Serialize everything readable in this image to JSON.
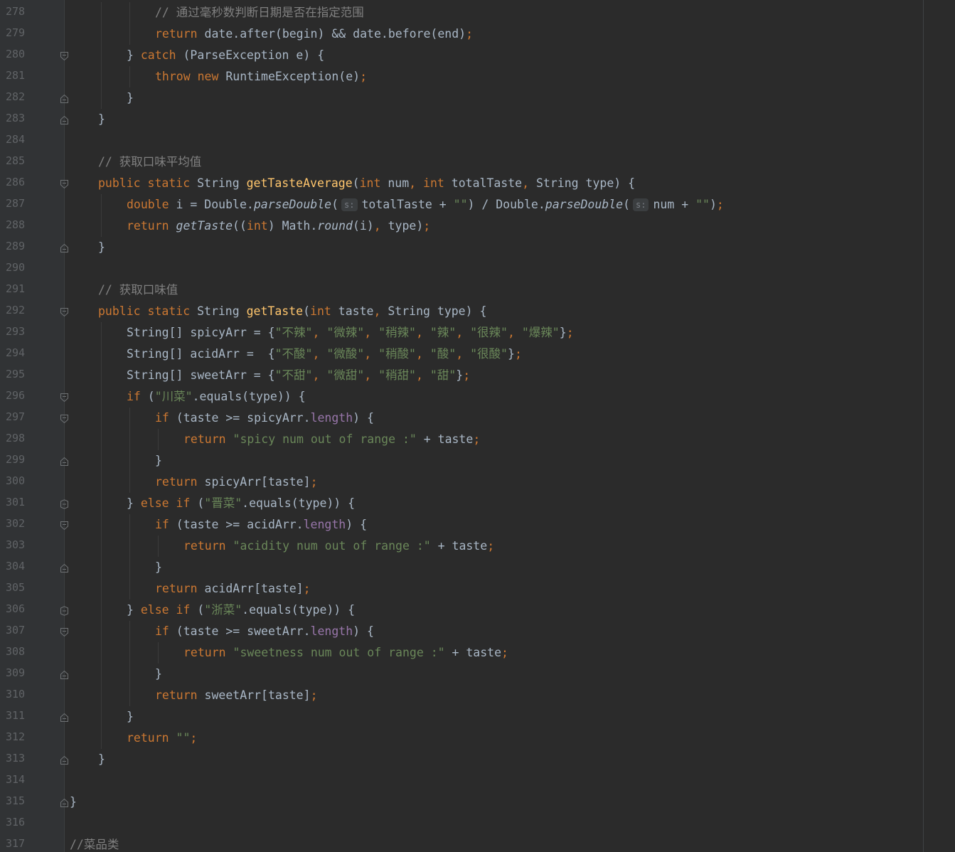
{
  "editor": {
    "theme": {
      "background": "#2b2b2b",
      "gutter": "#313335",
      "keyword": "#cc7832",
      "string": "#6a8759",
      "function": "#ffc66d",
      "comment": "#808080",
      "field": "#9876aa",
      "text": "#a9b7c6"
    },
    "lines": [
      {
        "no": "278",
        "indent": 3,
        "fold": null,
        "tokens": [
          {
            "t": "// 通过毫秒数判断日期是否在指定范围",
            "c": "cm"
          }
        ]
      },
      {
        "no": "279",
        "indent": 3,
        "fold": null,
        "tokens": [
          {
            "t": "return",
            "c": "kw"
          },
          {
            "t": " date.after(begin) && date.before(end)"
          },
          {
            "t": ";",
            "c": "kw"
          }
        ]
      },
      {
        "no": "280",
        "indent": 2,
        "fold": "open",
        "tokens": [
          {
            "t": "} "
          },
          {
            "t": "catch",
            "c": "kw"
          },
          {
            "t": " (ParseException e) {"
          }
        ]
      },
      {
        "no": "281",
        "indent": 3,
        "fold": null,
        "tokens": [
          {
            "t": "throw new",
            "c": "kw"
          },
          {
            "t": " RuntimeException(e)"
          },
          {
            "t": ";",
            "c": "kw"
          }
        ]
      },
      {
        "no": "282",
        "indent": 2,
        "fold": "close",
        "tokens": [
          {
            "t": "}"
          }
        ]
      },
      {
        "no": "283",
        "indent": 1,
        "fold": "close",
        "tokens": [
          {
            "t": "}"
          }
        ]
      },
      {
        "no": "284",
        "indent": 0,
        "fold": null,
        "tokens": []
      },
      {
        "no": "285",
        "indent": 1,
        "fold": null,
        "tokens": [
          {
            "t": "// 获取口味平均值",
            "c": "cm"
          }
        ]
      },
      {
        "no": "286",
        "indent": 1,
        "fold": "open",
        "tokens": [
          {
            "t": "public static",
            "c": "kw"
          },
          {
            "t": " String "
          },
          {
            "t": "getTasteAverage",
            "c": "fn"
          },
          {
            "t": "("
          },
          {
            "t": "int",
            "c": "kw"
          },
          {
            "t": " num"
          },
          {
            "t": ", ",
            "c": "kw"
          },
          {
            "t": "int",
            "c": "kw"
          },
          {
            "t": " totalTaste"
          },
          {
            "t": ", ",
            "c": "kw"
          },
          {
            "t": "String type) {"
          }
        ]
      },
      {
        "no": "287",
        "indent": 2,
        "fold": null,
        "tokens": [
          {
            "t": "double",
            "c": "kw"
          },
          {
            "t": " i = Double."
          },
          {
            "t": "parseDouble",
            "c": "it"
          },
          {
            "t": "("
          },
          {
            "t": "s:",
            "c": "hint"
          },
          {
            "t": "totalTaste + "
          },
          {
            "t": "\"\"",
            "c": "str"
          },
          {
            "t": ") / Double."
          },
          {
            "t": "parseDouble",
            "c": "it"
          },
          {
            "t": "("
          },
          {
            "t": "s:",
            "c": "hint"
          },
          {
            "t": "num + "
          },
          {
            "t": "\"\"",
            "c": "str"
          },
          {
            "t": ")"
          },
          {
            "t": ";",
            "c": "kw"
          }
        ]
      },
      {
        "no": "288",
        "indent": 2,
        "fold": null,
        "tokens": [
          {
            "t": "return",
            "c": "kw"
          },
          {
            "t": " "
          },
          {
            "t": "getTaste",
            "c": "it"
          },
          {
            "t": "(("
          },
          {
            "t": "int",
            "c": "kw"
          },
          {
            "t": ") Math."
          },
          {
            "t": "round",
            "c": "it"
          },
          {
            "t": "(i)"
          },
          {
            "t": ", ",
            "c": "kw"
          },
          {
            "t": "type)"
          },
          {
            "t": ";",
            "c": "kw"
          }
        ]
      },
      {
        "no": "289",
        "indent": 1,
        "fold": "close",
        "tokens": [
          {
            "t": "}"
          }
        ]
      },
      {
        "no": "290",
        "indent": 0,
        "fold": null,
        "tokens": []
      },
      {
        "no": "291",
        "indent": 1,
        "fold": null,
        "tokens": [
          {
            "t": "// 获取口味值",
            "c": "cm"
          }
        ]
      },
      {
        "no": "292",
        "indent": 1,
        "fold": "open",
        "tokens": [
          {
            "t": "public static",
            "c": "kw"
          },
          {
            "t": " String "
          },
          {
            "t": "getTaste",
            "c": "fn"
          },
          {
            "t": "("
          },
          {
            "t": "int",
            "c": "kw"
          },
          {
            "t": " taste"
          },
          {
            "t": ", ",
            "c": "kw"
          },
          {
            "t": "String type) {"
          }
        ]
      },
      {
        "no": "293",
        "indent": 2,
        "fold": null,
        "tokens": [
          {
            "t": "String[] spicyArr = {"
          },
          {
            "t": "\"不辣\"",
            "c": "str"
          },
          {
            "t": ", ",
            "c": "kw"
          },
          {
            "t": "\"微辣\"",
            "c": "str"
          },
          {
            "t": ", ",
            "c": "kw"
          },
          {
            "t": "\"稍辣\"",
            "c": "str"
          },
          {
            "t": ", ",
            "c": "kw"
          },
          {
            "t": "\"辣\"",
            "c": "str"
          },
          {
            "t": ", ",
            "c": "kw"
          },
          {
            "t": "\"很辣\"",
            "c": "str"
          },
          {
            "t": ", ",
            "c": "kw"
          },
          {
            "t": "\"爆辣\"",
            "c": "str"
          },
          {
            "t": "}"
          },
          {
            "t": ";",
            "c": "kw"
          }
        ]
      },
      {
        "no": "294",
        "indent": 2,
        "fold": null,
        "tokens": [
          {
            "t": "String[] acidArr =  {"
          },
          {
            "t": "\"不酸\"",
            "c": "str"
          },
          {
            "t": ", ",
            "c": "kw"
          },
          {
            "t": "\"微酸\"",
            "c": "str"
          },
          {
            "t": ", ",
            "c": "kw"
          },
          {
            "t": "\"稍酸\"",
            "c": "str"
          },
          {
            "t": ", ",
            "c": "kw"
          },
          {
            "t": "\"酸\"",
            "c": "str"
          },
          {
            "t": ", ",
            "c": "kw"
          },
          {
            "t": "\"很酸\"",
            "c": "str"
          },
          {
            "t": "}"
          },
          {
            "t": ";",
            "c": "kw"
          }
        ]
      },
      {
        "no": "295",
        "indent": 2,
        "fold": null,
        "tokens": [
          {
            "t": "String[] sweetArr = {"
          },
          {
            "t": "\"不甜\"",
            "c": "str"
          },
          {
            "t": ", ",
            "c": "kw"
          },
          {
            "t": "\"微甜\"",
            "c": "str"
          },
          {
            "t": ", ",
            "c": "kw"
          },
          {
            "t": "\"稍甜\"",
            "c": "str"
          },
          {
            "t": ", ",
            "c": "kw"
          },
          {
            "t": "\"甜\"",
            "c": "str"
          },
          {
            "t": "}"
          },
          {
            "t": ";",
            "c": "kw"
          }
        ]
      },
      {
        "no": "296",
        "indent": 2,
        "fold": "open",
        "tokens": [
          {
            "t": "if",
            "c": "kw"
          },
          {
            "t": " ("
          },
          {
            "t": "\"川菜\"",
            "c": "str"
          },
          {
            "t": ".equals(type)) {"
          }
        ]
      },
      {
        "no": "297",
        "indent": 3,
        "fold": "open",
        "tokens": [
          {
            "t": "if",
            "c": "kw"
          },
          {
            "t": " (taste >= spicyArr."
          },
          {
            "t": "length",
            "c": "fld"
          },
          {
            "t": ") {"
          }
        ]
      },
      {
        "no": "298",
        "indent": 4,
        "fold": null,
        "tokens": [
          {
            "t": "return",
            "c": "kw"
          },
          {
            "t": " "
          },
          {
            "t": "\"spicy num out of range :\"",
            "c": "str"
          },
          {
            "t": " + taste"
          },
          {
            "t": ";",
            "c": "kw"
          }
        ]
      },
      {
        "no": "299",
        "indent": 3,
        "fold": "close",
        "tokens": [
          {
            "t": "}"
          }
        ]
      },
      {
        "no": "300",
        "indent": 3,
        "fold": null,
        "tokens": [
          {
            "t": "return",
            "c": "kw"
          },
          {
            "t": " spicyArr[taste]"
          },
          {
            "t": ";",
            "c": "kw"
          }
        ]
      },
      {
        "no": "301",
        "indent": 2,
        "fold": "mid",
        "tokens": [
          {
            "t": "} "
          },
          {
            "t": "else if",
            "c": "kw"
          },
          {
            "t": " ("
          },
          {
            "t": "\"晋菜\"",
            "c": "str"
          },
          {
            "t": ".equals(type)) {"
          }
        ]
      },
      {
        "no": "302",
        "indent": 3,
        "fold": "open",
        "tokens": [
          {
            "t": "if",
            "c": "kw"
          },
          {
            "t": " (taste >= acidArr."
          },
          {
            "t": "length",
            "c": "fld"
          },
          {
            "t": ") {"
          }
        ]
      },
      {
        "no": "303",
        "indent": 4,
        "fold": null,
        "tokens": [
          {
            "t": "return",
            "c": "kw"
          },
          {
            "t": " "
          },
          {
            "t": "\"acidity num out of range :\"",
            "c": "str"
          },
          {
            "t": " + taste"
          },
          {
            "t": ";",
            "c": "kw"
          }
        ]
      },
      {
        "no": "304",
        "indent": 3,
        "fold": "close",
        "tokens": [
          {
            "t": "}"
          }
        ]
      },
      {
        "no": "305",
        "indent": 3,
        "fold": null,
        "tokens": [
          {
            "t": "return",
            "c": "kw"
          },
          {
            "t": " acidArr[taste]"
          },
          {
            "t": ";",
            "c": "kw"
          }
        ]
      },
      {
        "no": "306",
        "indent": 2,
        "fold": "mid",
        "tokens": [
          {
            "t": "} "
          },
          {
            "t": "else if",
            "c": "kw"
          },
          {
            "t": " ("
          },
          {
            "t": "\"浙菜\"",
            "c": "str"
          },
          {
            "t": ".equals(type)) {"
          }
        ]
      },
      {
        "no": "307",
        "indent": 3,
        "fold": "open",
        "tokens": [
          {
            "t": "if",
            "c": "kw"
          },
          {
            "t": " (taste >= sweetArr."
          },
          {
            "t": "length",
            "c": "fld"
          },
          {
            "t": ") {"
          }
        ]
      },
      {
        "no": "308",
        "indent": 4,
        "fold": null,
        "tokens": [
          {
            "t": "return",
            "c": "kw"
          },
          {
            "t": " "
          },
          {
            "t": "\"sweetness num out of range :\"",
            "c": "str"
          },
          {
            "t": " + taste"
          },
          {
            "t": ";",
            "c": "kw"
          }
        ]
      },
      {
        "no": "309",
        "indent": 3,
        "fold": "close",
        "tokens": [
          {
            "t": "}"
          }
        ]
      },
      {
        "no": "310",
        "indent": 3,
        "fold": null,
        "tokens": [
          {
            "t": "return",
            "c": "kw"
          },
          {
            "t": " sweetArr[taste]"
          },
          {
            "t": ";",
            "c": "kw"
          }
        ]
      },
      {
        "no": "311",
        "indent": 2,
        "fold": "close",
        "tokens": [
          {
            "t": "}"
          }
        ]
      },
      {
        "no": "312",
        "indent": 2,
        "fold": null,
        "tokens": [
          {
            "t": "return",
            "c": "kw"
          },
          {
            "t": " "
          },
          {
            "t": "\"\"",
            "c": "str"
          },
          {
            "t": ";",
            "c": "kw"
          }
        ]
      },
      {
        "no": "313",
        "indent": 1,
        "fold": "close",
        "tokens": [
          {
            "t": "}"
          }
        ]
      },
      {
        "no": "314",
        "indent": 0,
        "fold": null,
        "tokens": []
      },
      {
        "no": "315",
        "indent": 0,
        "fold": "close",
        "tokens": [
          {
            "t": "}"
          }
        ]
      },
      {
        "no": "316",
        "indent": 0,
        "fold": null,
        "tokens": []
      },
      {
        "no": "317",
        "indent": 0,
        "fold": null,
        "tokens": [
          {
            "t": "//菜品类",
            "c": "cm"
          }
        ]
      }
    ]
  }
}
